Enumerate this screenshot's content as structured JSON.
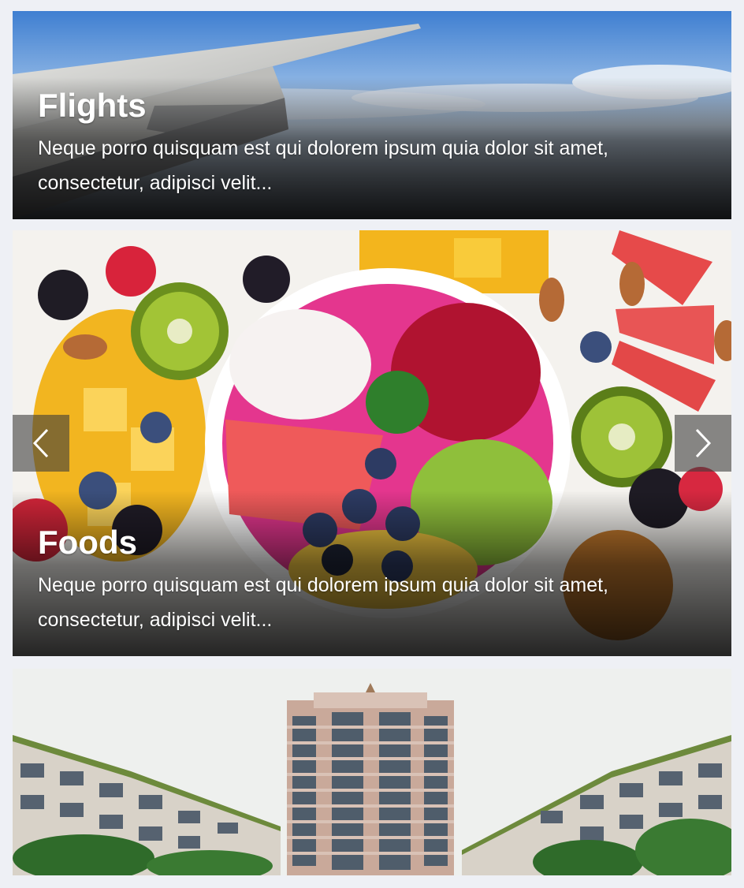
{
  "cards": [
    {
      "title": "Flights",
      "description": "Neque porro quisquam est qui dolorem ipsum quia dolor sit amet, consectetur, adipisci velit...",
      "image": "airplane-wing-sky"
    },
    {
      "title": "Foods",
      "description": "Neque porro quisquam est qui dolorem ipsum quia dolor sit amet, consectetur, adipisci velit...",
      "image": "fruit-smoothie-bowl",
      "prev_icon": "chevron-left-icon",
      "next_icon": "chevron-right-icon"
    },
    {
      "title": "",
      "description": "",
      "image": "hotel-buildings"
    }
  ],
  "colors": {
    "page_bg": "#eef0f5",
    "caption_text": "#ffffff",
    "nav_button_bg": "rgba(60,60,60,0.6)"
  }
}
